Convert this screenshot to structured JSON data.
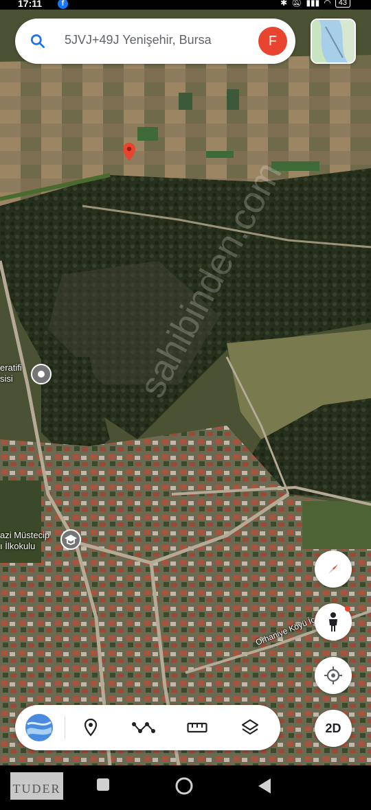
{
  "status_bar": {
    "time": "17:11",
    "battery": "43",
    "fb_icon": "facebook-icon"
  },
  "search": {
    "query": "5JVJ+49J Yenişehir, Bursa",
    "avatar_letter": "F"
  },
  "pois": [
    {
      "label_line1": "eratifi",
      "label_line2": "sisi",
      "icon": "pin-icon"
    },
    {
      "label_line1": "azi Müstecip",
      "label_line2": "ı İlkokulu",
      "icon": "school-icon"
    }
  ],
  "street_label": "Orhaniye Köyü İç Yol",
  "controls": {
    "two_d_label": "2D"
  },
  "toolbar_icons": [
    "google-maps-logo",
    "pin-icon",
    "route-icon",
    "ruler-icon",
    "layers-icon"
  ],
  "watermark": {
    "brand": "TUDER",
    "diagonal": "sahibinden.com"
  },
  "colors": {
    "accent_red": "#e8442f",
    "brand_blue": "#1a73e8",
    "poi_gray": "#757575"
  }
}
